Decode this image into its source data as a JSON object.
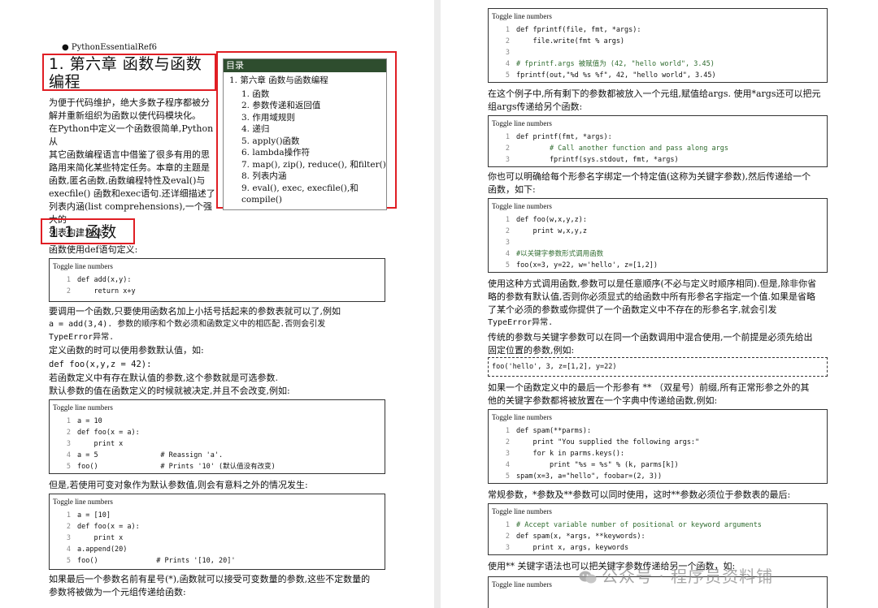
{
  "left": {
    "bullet": "PythonEssentialRef6",
    "chapter_title_line1": "1. 第六章 函数与函数",
    "chapter_title_line2": "编程",
    "intro": [
      "为便于代码维护，绝大多数子程序都被分",
      "解并重新组织为函数以使代码模块化。",
      "在Python中定义一个函数很简单,Python从",
      "其它函数编程语言中借鉴了很多有用的思",
      "路用来简化某些特定任务。本章的主题是",
      "函数,匿名函数,函数编程特性及eval()与",
      "execfile() 函数和exec语句.还详细描述了",
      "列表内涵(list comprehensions),一个强大的",
      "列表构建方法."
    ],
    "toc": {
      "title": "目录",
      "root": "1. 第六章 函数与函数编程",
      "items": [
        "1. 函数",
        "2. 参数传递和返回值",
        "3. 作用域规则",
        "4. 递归",
        "5. apply()函数",
        "6. lambda操作符",
        "7. map(), zip(), reduce(), 和filter()",
        "8. 列表内涵",
        "9. eval(), exec, execfile(),和compile()"
      ]
    },
    "section_title": "1.1. 函数",
    "p1": "函数使用def语句定义:",
    "toggle": "Toggle line numbers",
    "code1": [
      "def add(x,y):",
      "    return x+y"
    ],
    "p2_line1": "要调用一个函数,只要使用函数名加上小括号括起来的参数表就可以了,例如",
    "p2_line2": "a = add(3,4). 参数的顺序和个数必须和函数定义中的相匹配.否则会引发",
    "p2_line3": "TypeError异常.",
    "p3": "定义函数的时可以使用参数默认值，如:",
    "p3_code": "def foo(x,y,z = 42):",
    "p4": "若函数定义中有存在默认值的参数,这个参数就是可选参数.",
    "p5": "默认参数的值在函数定义的时候就被决定,并且不会改变,例如:",
    "code2": [
      "a = 10",
      "def foo(x = a):",
      "    print x",
      "a = 5               # Reassign 'a'.",
      "foo()               # Prints '10' (默认值没有改变)"
    ],
    "p6": "但是,若使用可变对象作为默认参数值,则会有意料之外的情况发生:",
    "code3": [
      "a = [10]",
      "def foo(x = a):",
      "    print x",
      "a.append(20)",
      "foo()              # Prints '[10, 20]'"
    ],
    "p7_line1": "如果最后一个参数名前有星号(*),函数就可以接受可变数量的参数,这些不定数量的",
    "p7_line2": "参数将被做为一个元组传递给函数:"
  },
  "right": {
    "toggle": "Toggle line numbers",
    "code1": [
      "def fprintf(file, fmt, *args):",
      "    file.write(fmt % args)",
      "",
      "# fprintf.args 被赋值为 (42, \"hello world\", 3.45)",
      "fprintf(out,\"%d %s %f\", 42, \"hello world\", 3.45)"
    ],
    "p1_line1": "在这个例子中,所有剩下的参数都被放入一个元组,赋值给args. 使用*args还可以把元",
    "p1_line2": "组args传递给另个函数:",
    "code2": [
      "def printf(fmt, *args):",
      "        # Call another function and pass along args",
      "        fprintf(sys.stdout, fmt, *args)"
    ],
    "p2_line1": "你也可以明确给每个形参名字绑定一个特定值(这称为关键字参数),然后传递给一个",
    "p2_line2": "函数，如下:",
    "code3": [
      "def foo(w,x,y,z):",
      "    print w,x,y,z",
      "",
      "#以关键字参数形式调用函数",
      "foo(x=3, y=22, w='hello', z=[1,2])"
    ],
    "p3_line1": "使用这种方式调用函数,参数可以是任意顺序(不必与定义时顺序相同).但是,除非你省",
    "p3_line2": "略的参数有默认值,否则你必须显式的给函数中所有形参名字指定一个值.如果是省略",
    "p3_line3": "了某个必须的参数或你提供了一个函数定义中不存在的形参名字,就会引发",
    "p3_line4": "TypeError异常.",
    "p4_line1": "传统的参数与关键字参数可以在同一个函数调用中混合使用,一个前提是必须先给出",
    "p4_line2": "固定位置的参数,例如:",
    "inline_code": "foo('hello', 3, z=[1,2], y=22)",
    "p5_line1": "如果一个函数定义中的最后一个形参有 ** （双星号）前缀,所有正常形参之外的其",
    "p5_line2": "他的关键字参数都将被放置在一个字典中传递给函数,例如:",
    "code4": [
      "def spam(**parms):",
      "    print \"You supplied the following args:\"",
      "    for k in parms.keys():",
      "        print \"%s = %s\" % (k, parms[k])",
      "spam(x=3, a=\"hello\", foobar=(2, 3))"
    ],
    "p6": "常规参数，*参数及**参数可以同时使用，这时**参数必须位于参数表的最后:",
    "code5": [
      "# Accept variable number of positional or keyword arguments",
      "def spam(x, *args, **keywords):",
      "    print x, args, keywords"
    ],
    "p7": "使用** 关键字语法也可以把关键字参数传递给另一个函数，如:",
    "watermark": "公众号 · 程序员资料铺"
  }
}
